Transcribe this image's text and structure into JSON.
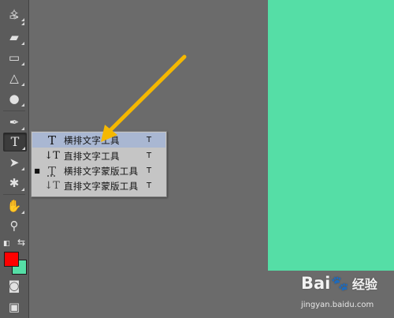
{
  "toolbar": {
    "tools": [
      {
        "name": "patch-tool-icon",
        "glyph": "✧"
      },
      {
        "name": "history-brush-icon",
        "glyph": "✑"
      },
      {
        "name": "eraser-icon",
        "glyph": "▰"
      },
      {
        "name": "gradient-icon",
        "glyph": "▭"
      },
      {
        "name": "blur-icon",
        "glyph": "△"
      },
      {
        "name": "dodge-icon",
        "glyph": "●"
      },
      {
        "name": "pen-icon",
        "glyph": "✒"
      },
      {
        "name": "type-tool-icon",
        "glyph": "T"
      },
      {
        "name": "path-selection-icon",
        "glyph": "➤"
      },
      {
        "name": "custom-shape-icon",
        "glyph": "✱"
      },
      {
        "name": "hand-icon",
        "glyph": "✋"
      },
      {
        "name": "zoom-icon",
        "glyph": "⚲"
      },
      {
        "name": "quick-mask-icon",
        "glyph": "◙"
      },
      {
        "name": "screen-mode-icon",
        "glyph": "▣"
      }
    ],
    "foreground_color": "#ff0000",
    "background_color": "#55dea6"
  },
  "flyout": {
    "items": [
      {
        "icon": "T",
        "label": "横排文字工具",
        "shortcut": "T",
        "selected": true,
        "current": false
      },
      {
        "icon": "↓T",
        "label": "直排文字工具",
        "shortcut": "T",
        "selected": false,
        "current": false
      },
      {
        "icon": "T",
        "label": "横排文字蒙版工具",
        "shortcut": "T",
        "selected": false,
        "current": true
      },
      {
        "icon": "↓T",
        "label": "直排文字蒙版工具",
        "shortcut": "T",
        "selected": false,
        "current": false
      }
    ]
  },
  "canvas_color": "#55dea6",
  "arrow_color": "#f5b800",
  "watermark": {
    "logo_left": "Bai",
    "logo_right": "经验",
    "url": "jingyan.baidu.com"
  }
}
